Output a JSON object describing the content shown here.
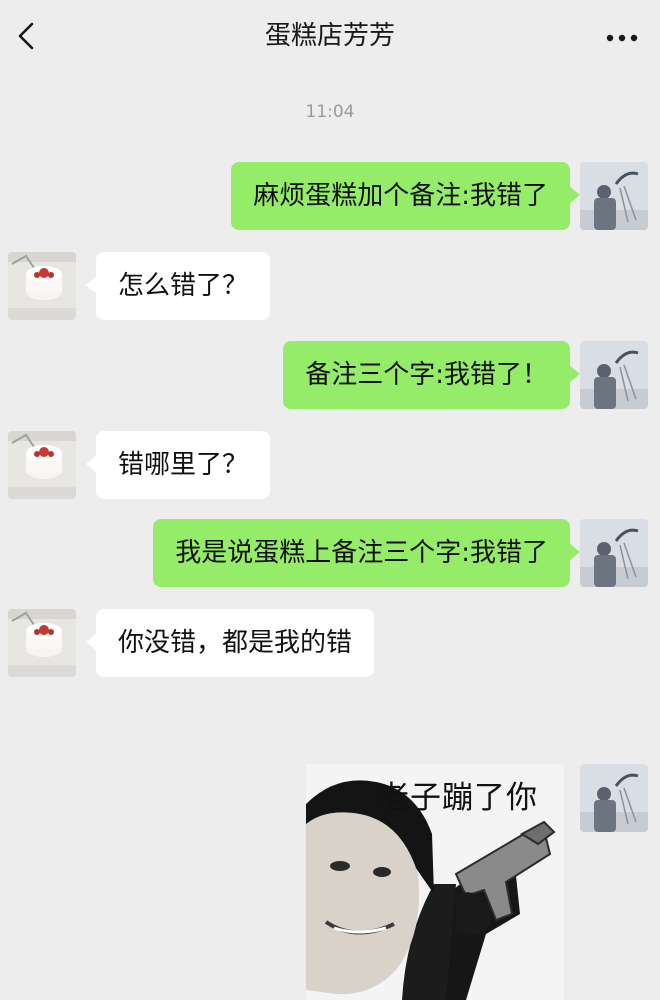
{
  "header": {
    "back_icon": "chevron-left-icon",
    "title": "蛋糕店芳芳",
    "more_icon": "more-dots-icon"
  },
  "timestamp": "11:04",
  "messages": [
    {
      "direction": "out",
      "text": "麻烦蛋糕加个备注:我错了"
    },
    {
      "direction": "in",
      "text": "怎么错了？"
    },
    {
      "direction": "out",
      "text": "备注三个字:我错了！"
    },
    {
      "direction": "in",
      "text": "错哪里了？"
    },
    {
      "direction": "out",
      "text": "我是说蛋糕上备注三个字:我错了"
    },
    {
      "direction": "in",
      "text": "你没错，都是我的错"
    },
    {
      "direction": "out",
      "type": "sticker",
      "caption": "老子蹦了你"
    }
  ],
  "colors": {
    "background": "#ededed",
    "outgoing_bubble": "#95ec69",
    "incoming_bubble": "#ffffff"
  }
}
